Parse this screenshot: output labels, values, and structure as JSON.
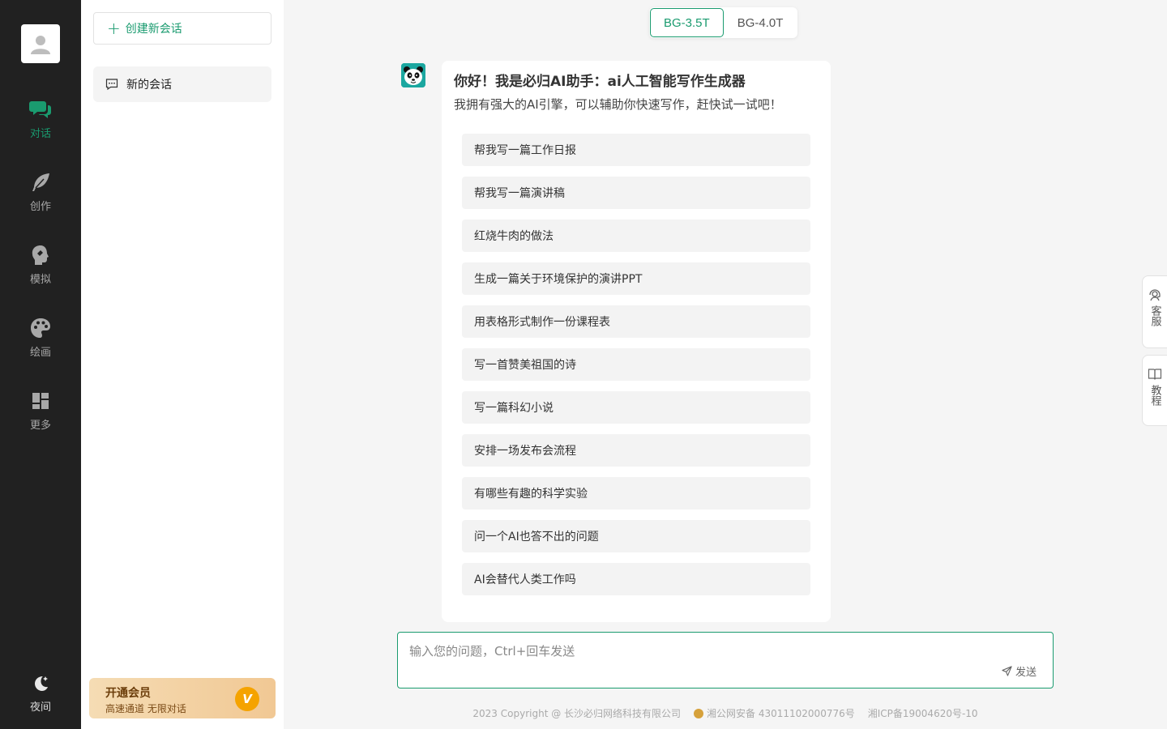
{
  "colors": {
    "accent": "#1a9b6f",
    "rail_bg": "#212121",
    "vip_badge": "#f5a300"
  },
  "rail": {
    "items": [
      {
        "label": "对话",
        "icon": "chat-icon",
        "active": true
      },
      {
        "label": "创作",
        "icon": "feather-icon"
      },
      {
        "label": "模拟",
        "icon": "head-icon"
      },
      {
        "label": "绘画",
        "icon": "palette-icon"
      },
      {
        "label": "更多",
        "icon": "grid-icon"
      }
    ],
    "night_label": "夜间"
  },
  "sidebar": {
    "new_chat_label": "创建新会话",
    "conversations": [
      {
        "title": "新的会话"
      }
    ],
    "vip": {
      "title": "开通会员",
      "subtitle": "高速通道 无限对话",
      "badge": "V"
    }
  },
  "models": {
    "tabs": [
      "BG-3.5T",
      "BG-4.0T"
    ],
    "active": "BG-3.5T"
  },
  "welcome": {
    "title": "你好！我是必归AI助手：ai人工智能写作生成器",
    "subtitle": "我拥有强大的AI引擎，可以辅助你快速写作，赶快试一试吧！",
    "suggestions": [
      "帮我写一篇工作日报",
      "帮我写一篇演讲稿",
      "红烧牛肉的做法",
      "生成一篇关于环境保护的演讲PPT",
      "用表格形式制作一份课程表",
      "写一首赞美祖国的诗",
      "写一篇科幻小说",
      "安排一场发布会流程",
      "有哪些有趣的科学实验",
      "问一个AI也答不出的问题",
      "AI会替代人类工作吗"
    ]
  },
  "input": {
    "placeholder": "输入您的问题，Ctrl+回车发送",
    "value": "",
    "send_label": "发送"
  },
  "footer": {
    "copyright": "2023 Copyright @ 长沙必归网络科技有限公司",
    "police": "湘公网安备 43011102000776号",
    "icp": "湘ICP备19004620号-10"
  },
  "floating": {
    "service": "客服",
    "tutorial": "教程"
  }
}
